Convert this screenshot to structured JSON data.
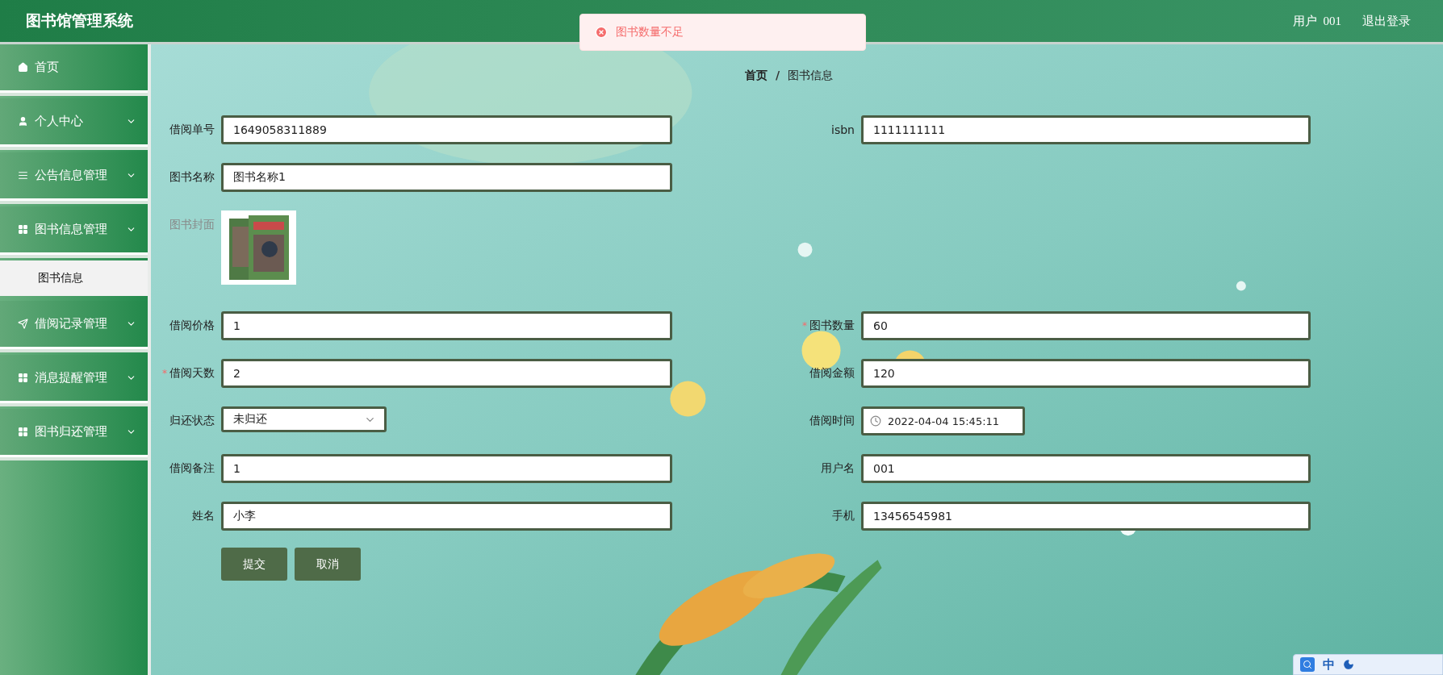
{
  "header": {
    "title": "图书馆管理系统",
    "user_label": "用户",
    "user_name": "001",
    "logout": "退出登录"
  },
  "toast": {
    "message": "图书数量不足"
  },
  "sidebar": {
    "items": [
      {
        "label": "首页",
        "has_arrow": false
      },
      {
        "label": "个人中心",
        "has_arrow": true
      },
      {
        "label": "公告信息管理",
        "has_arrow": true
      },
      {
        "label": "图书信息管理",
        "has_arrow": true,
        "children": [
          {
            "label": "图书信息",
            "selected": true
          }
        ]
      },
      {
        "label": "借阅记录管理",
        "has_arrow": true
      },
      {
        "label": "消息提醒管理",
        "has_arrow": true
      },
      {
        "label": "图书归还管理",
        "has_arrow": true
      }
    ]
  },
  "breadcrumb": {
    "items": [
      "首页",
      "图书信息"
    ],
    "separator": "/"
  },
  "form": {
    "rows": [
      {
        "left": {
          "label": "借阅单号",
          "kind": "text",
          "value": "1649058311889"
        },
        "right": {
          "label": "isbn",
          "kind": "text",
          "value": "1111111111"
        }
      },
      {
        "left": {
          "label": "图书名称",
          "kind": "text",
          "value": "图书名称1"
        }
      },
      {
        "left": {
          "label": "图书封面"
        }
      },
      {
        "left": {
          "label": "借阅价格",
          "kind": "text",
          "value": "1"
        },
        "right": {
          "label": "图书数量",
          "kind": "text",
          "value": "60",
          "required_mark": "*"
        }
      },
      {
        "left": {
          "label": "借阅天数",
          "kind": "text",
          "value": "2",
          "required_mark": "*"
        },
        "right": {
          "label": "借阅金额",
          "kind": "text",
          "value": "120"
        }
      },
      {
        "left": {
          "label": "归还状态",
          "kind": "select",
          "value": "未归还"
        },
        "right": {
          "label": "借阅时间",
          "kind": "datetime",
          "value": "2022-04-04 15:45:11"
        }
      },
      {
        "left": {
          "label": "借阅备注",
          "kind": "text",
          "value": "1"
        },
        "right": {
          "label": "用户名",
          "kind": "text",
          "value": "001"
        }
      },
      {
        "left": {
          "label": "姓名",
          "kind": "text",
          "value": "小李"
        },
        "right": {
          "label": "手机",
          "kind": "text",
          "value": "13456545981"
        }
      }
    ],
    "buttons": [
      "提交",
      "取消"
    ]
  },
  "ime_bar": {
    "mode": "中"
  }
}
